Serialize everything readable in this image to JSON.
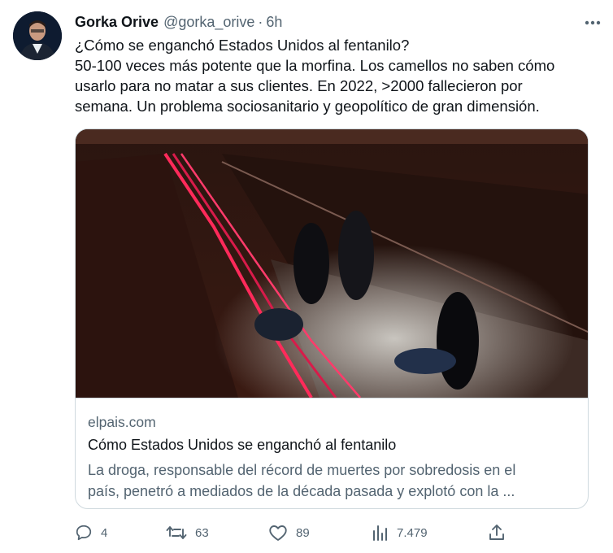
{
  "author": {
    "name": "Gorka Orive",
    "handle": "@gorka_orive",
    "separator": "·",
    "time": "6h"
  },
  "tweet_text": [
    "¿Cómo se enganchó Estados Unidos al fentanilo?",
    "50-100 veces más potente que la morfina. Los camellos no saben cómo",
    "usarlo para no matar a sus clientes. En 2022, >2000 fallecieron por",
    "semana. Un problema sociosanitario y geopolítico de gran dimensión."
  ],
  "card": {
    "domain": "elpais.com",
    "title": "Cómo Estados Unidos se enganchó al fentanilo",
    "description": [
      "La droga, responsable del récord de muertes por sobredosis en el",
      "país, penetró a mediados de la década pasada y explotó con la ..."
    ]
  },
  "actions": {
    "reply_count": "4",
    "retweet_count": "63",
    "like_count": "89",
    "view_count": "7.479"
  },
  "colors": {
    "text": "#0f1419",
    "secondary": "#536471",
    "border": "#cfd9de"
  },
  "icons": [
    "more-icon",
    "reply-icon",
    "retweet-icon",
    "like-icon",
    "views-icon",
    "share-icon"
  ]
}
